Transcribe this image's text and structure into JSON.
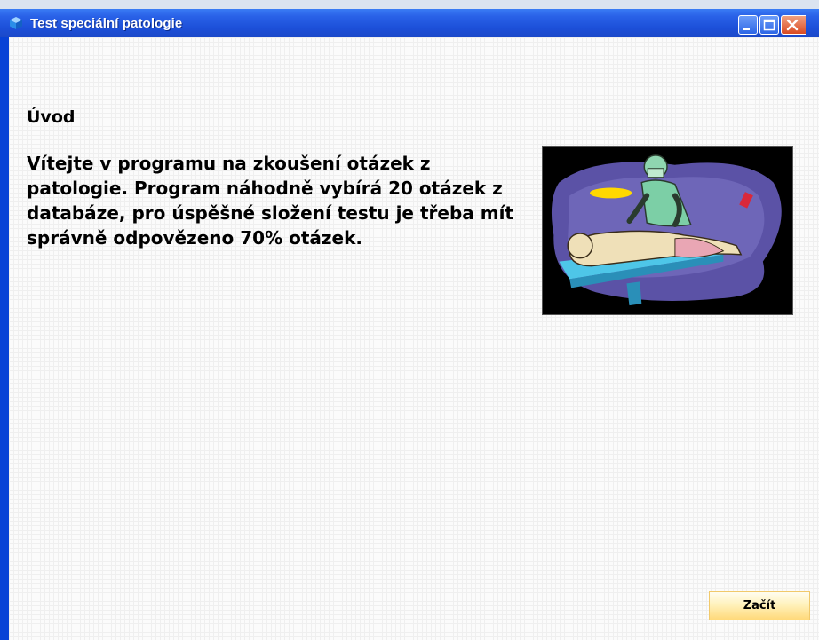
{
  "window": {
    "title": "Test speciální patologie",
    "app_icon": "blue-cube-icon",
    "controls": [
      "minimize-icon",
      "maximize-icon",
      "close-icon"
    ]
  },
  "content": {
    "heading": "Úvod",
    "intro_text": "Vítejte v programu na zkoušení otázek z patologie. Program náhodně vybírá 20 otázek z databáze, pro úspěšné složení testu je třeba mít správně odpovězeno 70% otázek.",
    "illustration": "pathologist-autopsy-clipart"
  },
  "actions": {
    "start_label": "Začít"
  },
  "colors": {
    "titlebar": "#1c4fd8",
    "button_fill": "#ffd97a",
    "button_border": "#f1c96b"
  }
}
